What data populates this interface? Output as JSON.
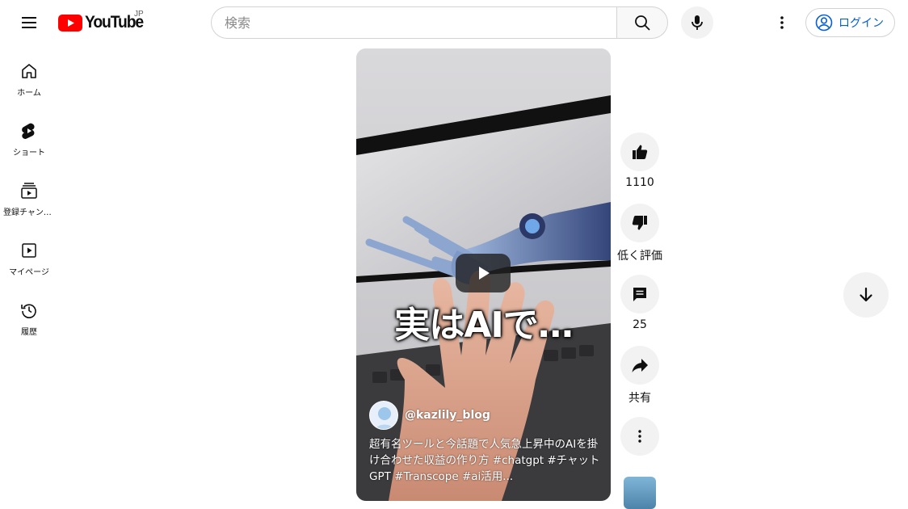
{
  "header": {
    "logo_text": "YouTube",
    "region": "JP",
    "search_placeholder": "検索",
    "login_label": "ログイン"
  },
  "sidebar": {
    "items": [
      {
        "label": "ホーム",
        "icon": "home-icon"
      },
      {
        "label": "ショート",
        "icon": "shorts-icon"
      },
      {
        "label": "登録チャンネル",
        "icon": "subscriptions-icon"
      },
      {
        "label": "マイページ",
        "icon": "library-icon"
      },
      {
        "label": "履歴",
        "icon": "history-icon"
      }
    ]
  },
  "short": {
    "overlay_text": "実はAIで…",
    "channel_handle": "@kazlily_blog",
    "caption": "超有名ツールと今話題で人気急上昇中のAIを掛け合わせた収益の作り方 #chatgpt #チャットGPT #Transcope #ai活用..."
  },
  "actions": {
    "like_count": "1110",
    "dislike_label": "低く評価",
    "comment_count": "25",
    "share_label": "共有"
  },
  "colors": {
    "brand_red": "#ff0000",
    "link_blue": "#065fd4",
    "button_gray": "#f2f2f2"
  }
}
